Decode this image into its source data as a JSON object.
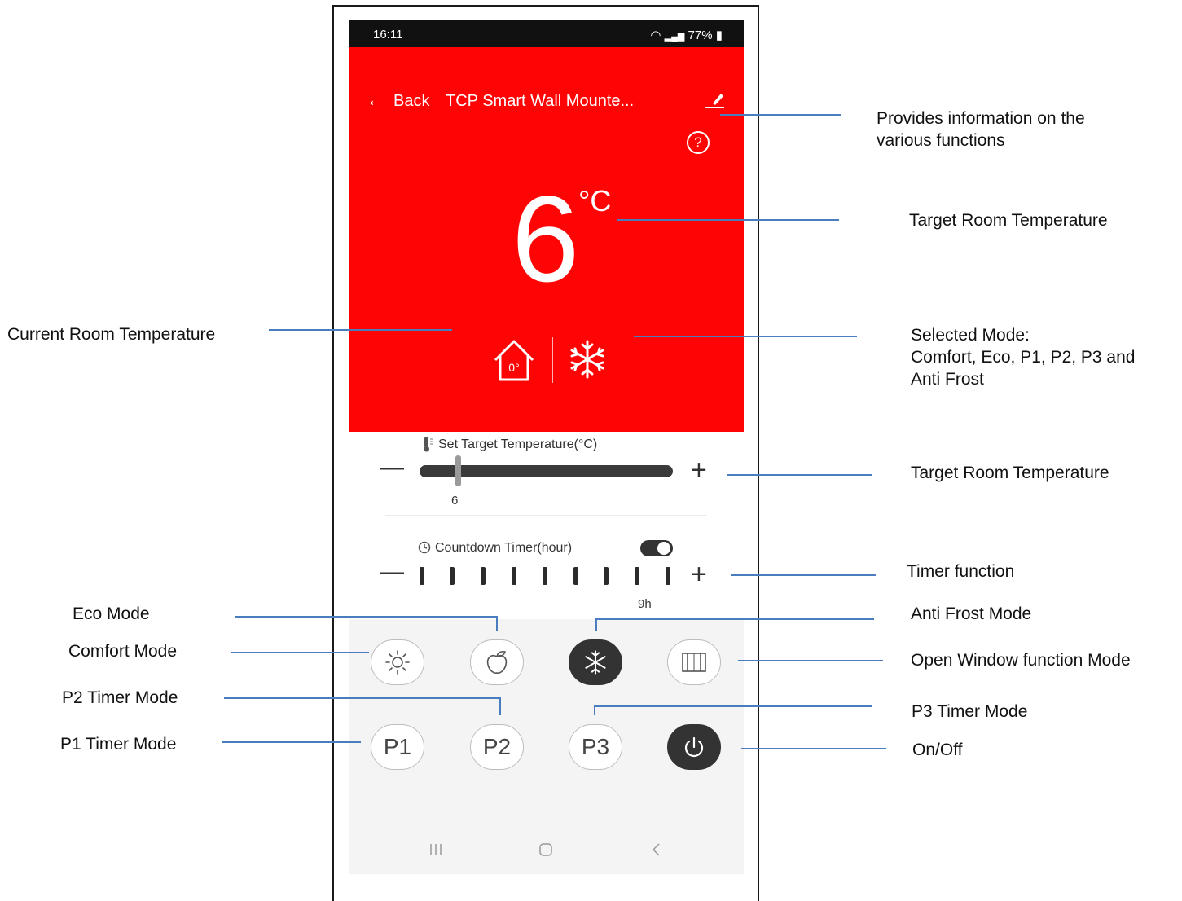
{
  "status_bar": {
    "time": "16:11",
    "signal_battery": "77%"
  },
  "header": {
    "back_label": "Back",
    "device_name": "TCP Smart Wall Mounte..."
  },
  "help": {
    "symbol": "?"
  },
  "display": {
    "target_temperature": "6",
    "unit": "°C",
    "current_room_temperature": "0°",
    "selected_mode_icon": "snowflake-icon"
  },
  "target_temp_control": {
    "label": "Set Target Temperature(°C)",
    "minus": "—",
    "plus": "+",
    "value": "6"
  },
  "countdown_timer": {
    "label": "Countdown Timer(hour)",
    "enabled": true,
    "minus": "—",
    "plus": "+",
    "value": "9h",
    "level": 9
  },
  "mode_buttons": {
    "comfort_icon": "sun-icon",
    "eco_icon": "leaf-icon",
    "anti_frost_icon": "snowflake-icon",
    "open_window_icon": "window-icon",
    "p1": "P1",
    "p2": "P2",
    "p3": "P3",
    "power_icon": "power-icon"
  },
  "navigation_bar": {
    "recents_icon": "recents-icon",
    "home_icon": "home-icon",
    "back_icon": "back-chevron-icon"
  },
  "annotations": {
    "info": [
      "Provides information on the",
      "various functions"
    ],
    "target_room_temperature_1": "Target Room Temperature",
    "current_room_temperature": "Current Room Temperature",
    "selected_mode": [
      "Selected Mode:",
      "Comfort, Eco, P1, P2, P3 and",
      "Anti Frost"
    ],
    "target_room_temperature_2": "Target Room Temperature",
    "timer_function": "Timer function",
    "eco_mode": "Eco Mode",
    "anti_frost_mode": "Anti Frost Mode",
    "comfort_mode": "Comfort Mode",
    "open_window_mode": "Open Window function Mode",
    "p2_timer_mode": "P2 Timer Mode",
    "p3_timer_mode": "P3 Timer Mode",
    "p1_timer_mode": "P1 Timer Mode",
    "on_off": "On/Off"
  },
  "colors": {
    "panel_red": "#fe0404",
    "dark_button": "#333333",
    "annotation_line": "#4a7cc0"
  }
}
